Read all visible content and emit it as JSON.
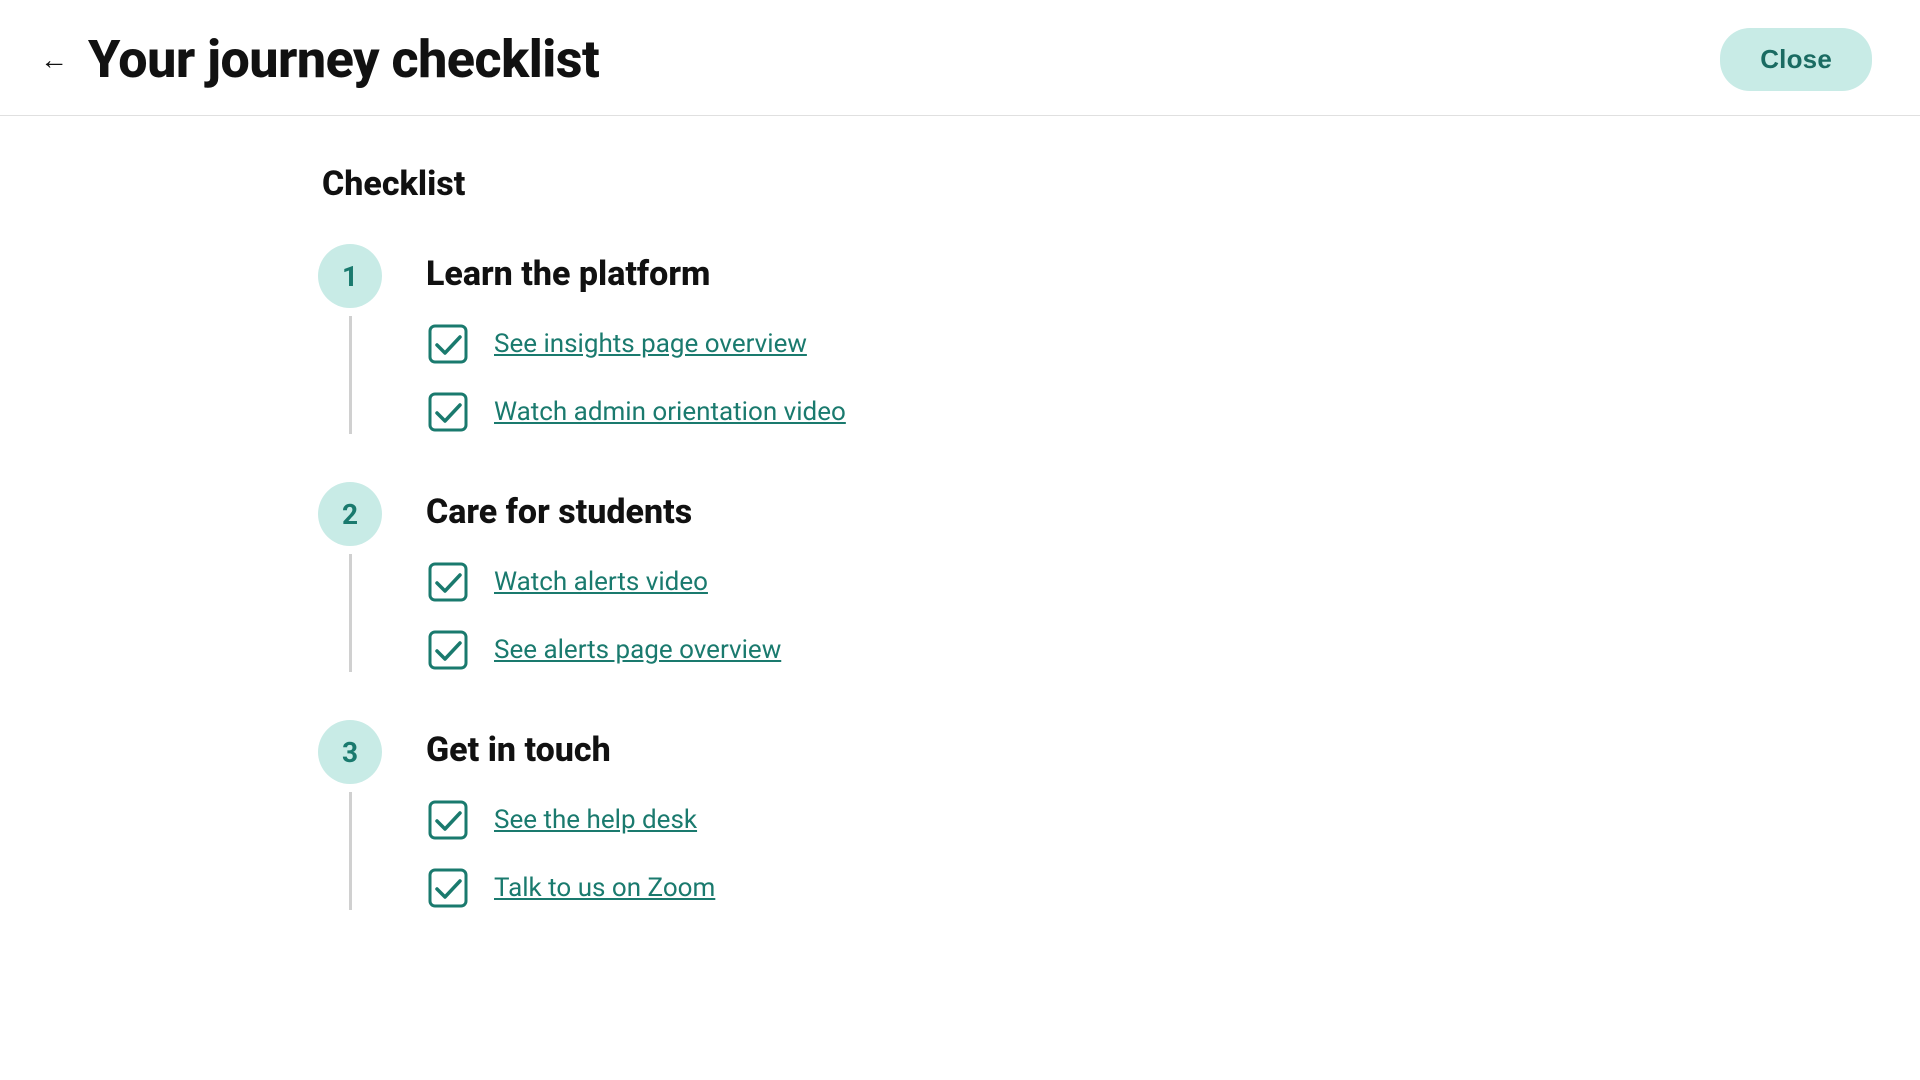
{
  "header": {
    "title": "Your journey checklist",
    "back_label": "←",
    "close_label": "Close"
  },
  "checklist": {
    "section_title": "Checklist",
    "groups": [
      {
        "step": "1",
        "heading": "Learn the platform",
        "items": [
          {
            "label": "See insights page overview"
          },
          {
            "label": "Watch admin orientation video"
          }
        ]
      },
      {
        "step": "2",
        "heading": "Care for students",
        "items": [
          {
            "label": "Watch alerts video"
          },
          {
            "label": "See alerts page overview"
          }
        ]
      },
      {
        "step": "3",
        "heading": "Get in touch",
        "items": [
          {
            "label": "See the help desk"
          },
          {
            "label": "Talk to us on Zoom"
          }
        ]
      }
    ]
  },
  "colors": {
    "accent": "#1a7a6e",
    "circle_bg": "#c8ebe6",
    "close_bg": "#c8ebe6"
  }
}
